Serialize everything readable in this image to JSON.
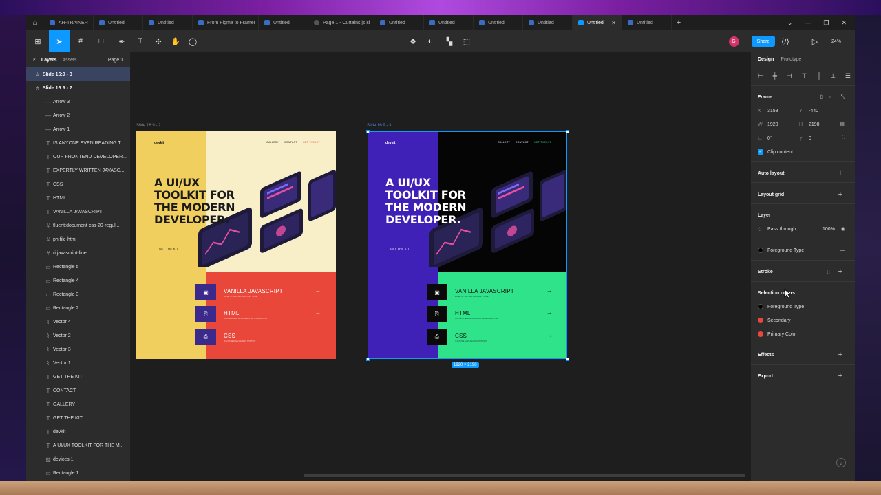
{
  "tabs": [
    {
      "label": "AR-TRAINER",
      "active": false
    },
    {
      "label": "Untitled",
      "active": false
    },
    {
      "label": "Untitled",
      "active": false
    },
    {
      "label": "From Figma to Framer",
      "active": false
    },
    {
      "label": "Untitled",
      "active": false
    },
    {
      "label": "Page 1 - Curtains.js sl",
      "active": false
    },
    {
      "label": "Untitled",
      "active": false
    },
    {
      "label": "Untitled",
      "active": false
    },
    {
      "label": "Untitled",
      "active": false
    },
    {
      "label": "Untitled",
      "active": false
    },
    {
      "label": "Untitled",
      "active": true
    },
    {
      "label": "Untitled",
      "active": false
    }
  ],
  "toolbar": {
    "share_label": "Share",
    "zoom_label": "24%",
    "avatar_letter": "G",
    "avatar_color": "#d6336c",
    "accent": "#0d99ff"
  },
  "left_panel": {
    "tab_layers": "Layers",
    "tab_assets": "Assets",
    "page_label": "Page 1",
    "frames": [
      "Slide 16:9 - 3",
      "Slide 16:9 - 2"
    ],
    "layers": [
      {
        "label": "Arrow 3",
        "icon": "line-icon"
      },
      {
        "label": "Arrow 2",
        "icon": "line-icon"
      },
      {
        "label": "Arrow 1",
        "icon": "line-icon"
      },
      {
        "label": "IS ANYONE EVEN READING T...",
        "icon": "text-icon"
      },
      {
        "label": "OUR FRONTEND DEVELOPER...",
        "icon": "text-icon"
      },
      {
        "label": "EXPERTLY WRITTEN JAVASC...",
        "icon": "text-icon"
      },
      {
        "label": "CSS",
        "icon": "text-icon"
      },
      {
        "label": "HTML",
        "icon": "text-icon"
      },
      {
        "label": "VANILLA JAVASCRIPT",
        "icon": "text-icon"
      },
      {
        "label": "fluent:document-css-20-regul...",
        "icon": "frame-icon"
      },
      {
        "label": "ph:file-html",
        "icon": "frame-icon"
      },
      {
        "label": "ri:javascript-line",
        "icon": "frame-icon"
      },
      {
        "label": "Rectangle 5",
        "icon": "rectangle-icon"
      },
      {
        "label": "Rectangle 4",
        "icon": "rectangle-icon"
      },
      {
        "label": "Rectangle 3",
        "icon": "rectangle-icon"
      },
      {
        "label": "Rectangle 2",
        "icon": "rectangle-icon"
      },
      {
        "label": "Vector 4",
        "icon": "vector-icon"
      },
      {
        "label": "Vector 2",
        "icon": "vector-icon"
      },
      {
        "label": "Vector 3",
        "icon": "vector-icon"
      },
      {
        "label": "Vector 1",
        "icon": "vector-icon"
      },
      {
        "label": "GET THE KIT",
        "icon": "text-icon"
      },
      {
        "label": "CONTACT",
        "icon": "text-icon"
      },
      {
        "label": "GALLERY",
        "icon": "text-icon"
      },
      {
        "label": "GET THE KIT",
        "icon": "text-icon"
      },
      {
        "label": "devkit",
        "icon": "text-icon"
      },
      {
        "label": "A UI/UX TOOLKIT FOR THE M...",
        "icon": "text-icon"
      },
      {
        "label": "devices 1",
        "icon": "image-icon"
      },
      {
        "label": "Rectangle 1",
        "icon": "rectangle-icon"
      }
    ]
  },
  "canvas": {
    "slide2": {
      "label": "Slide 16:9 - 2",
      "logo": "devkit",
      "nav": [
        "GALLERY",
        "CONTACT",
        "GET THE KIT"
      ],
      "headline": "A UI/UX TOOLKIT FOR THE MODERN DEVELOPER.",
      "cta": "GET THE KIT",
      "items": [
        {
          "name": "VANILLA JAVASCRIPT",
          "sub": "EXPERTLY WRITTEN JAVASCRIPT CODE"
        },
        {
          "name": "HTML",
          "sub": "OUR FRONTEND DEVELOPERS WRITE CLEAN HTML"
        },
        {
          "name": "CSS",
          "sub": "IS ANYONE EVEN READING THIS TEXT"
        }
      ],
      "colors": {
        "left": "#f0cf5e",
        "right": "#f8efc9",
        "bottom": "#e8473a",
        "icon_bg": "#3b2a8c",
        "text": "#1a1a1a",
        "item_text": "#ffffff",
        "accent": "#e8473a"
      }
    },
    "slide3": {
      "label": "Slide 16:9 - 3",
      "logo": "devkit",
      "nav": [
        "GALLERY",
        "CONTACT",
        "GET THE KIT"
      ],
      "headline": "A UI/UX TOOLKIT FOR THE MODERN DEVELOPER.",
      "cta": "GET THE KIT",
      "items": [
        {
          "name": "VANILLA JAVASCRIPT",
          "sub": "EXPERTLY WRITTEN JAVASCRIPT CODE"
        },
        {
          "name": "HTML",
          "sub": "OUR FRONTEND DEVELOPERS WRITE CLEAN HTML"
        },
        {
          "name": "CSS",
          "sub": "IS ANYONE EVEN READING THIS TEXT"
        }
      ],
      "colors": {
        "left": "#4021b8",
        "right": "#050505",
        "bottom": "#2fe38a",
        "icon_bg": "#0a0a0a",
        "text": "#ffffff",
        "item_text": "#111111",
        "accent": "#2fe38a"
      }
    },
    "dimensions_badge": "1920 × 2198"
  },
  "right_panel": {
    "tab_design": "Design",
    "tab_prototype": "Prototype",
    "frame_label": "Frame",
    "x_label": "X",
    "x_value": "3158",
    "y_label": "Y",
    "y_value": "-440",
    "w_label": "W",
    "w_value": "1920",
    "h_label": "H",
    "h_value": "2198",
    "rotation_value": "0°",
    "radius_value": "0",
    "clip_content": "Clip content",
    "auto_layout": "Auto layout",
    "layout_grid": "Layout grid",
    "layer_label": "Layer",
    "blend_mode": "Pass through",
    "opacity": "100%",
    "fill_name": "Foreground Type",
    "stroke_label": "Stroke",
    "selection_colors_label": "Selection colors",
    "selection_colors": [
      {
        "name": "Foreground Type",
        "color": "#000000"
      },
      {
        "name": "Secondary",
        "color": "#e8473a"
      },
      {
        "name": "Primary Color",
        "color": "#e8473a"
      }
    ],
    "effects_label": "Effects",
    "export_label": "Export"
  }
}
